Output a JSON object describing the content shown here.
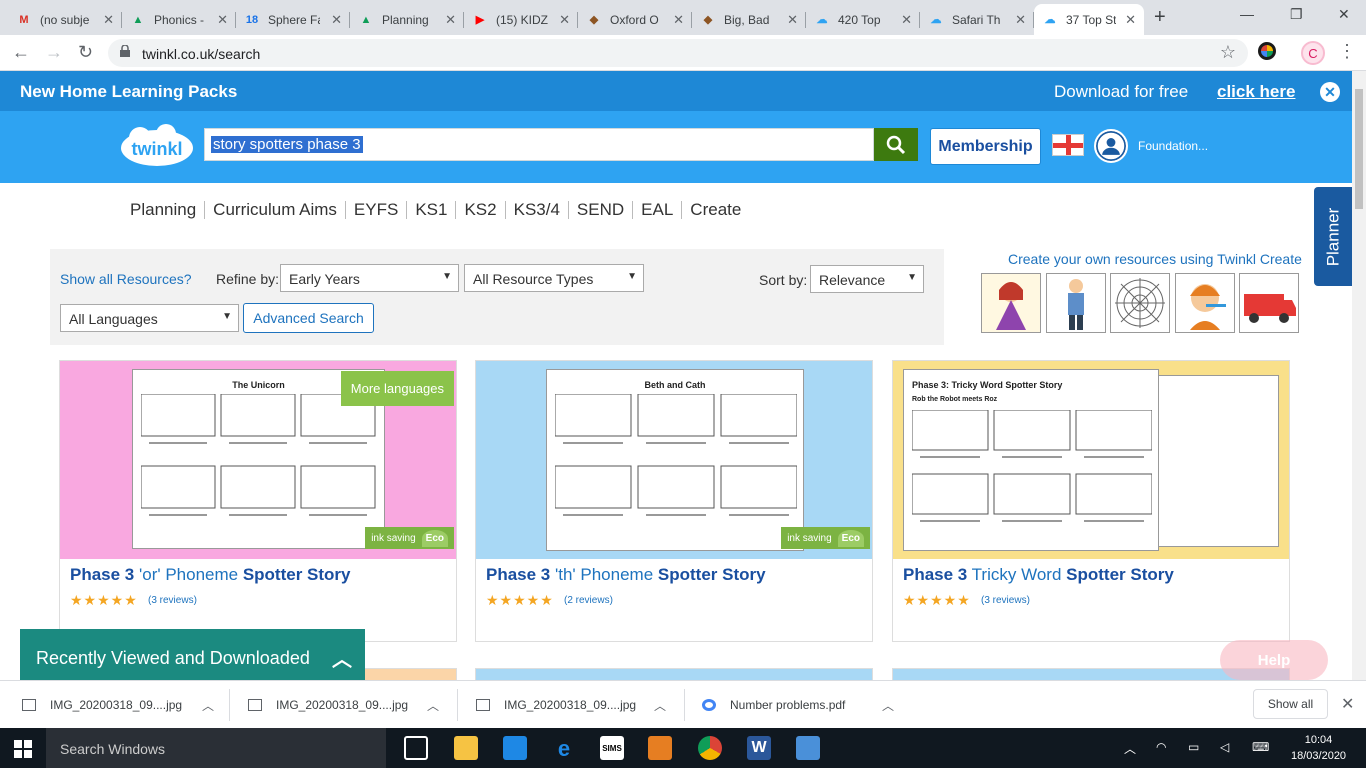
{
  "browser": {
    "tabs": [
      {
        "title": "(no subje",
        "icon": "gmail-icon",
        "color": "#d93025",
        "glyph": "M"
      },
      {
        "title": "Phonics -",
        "icon": "google-drive-icon",
        "color": "#0f9d58",
        "glyph": "▲"
      },
      {
        "title": "Sphere Fa",
        "icon": "calendar-icon",
        "color": "#1a73e8",
        "glyph": "18"
      },
      {
        "title": "Planning",
        "icon": "google-drive-icon",
        "color": "#0f9d58",
        "glyph": "▲"
      },
      {
        "title": "(15) KIDZ",
        "icon": "youtube-icon",
        "color": "#ff0000",
        "glyph": "▶"
      },
      {
        "title": "Oxford O",
        "icon": "owl-icon",
        "color": "#8d5524",
        "glyph": "◆"
      },
      {
        "title": "Big, Bad",
        "icon": "owl-icon",
        "color": "#8d5524",
        "glyph": "◆"
      },
      {
        "title": "420 Top",
        "icon": "twinkl-icon",
        "color": "#2ea3f2",
        "glyph": "☁"
      },
      {
        "title": "Safari Th",
        "icon": "twinkl-icon",
        "color": "#2ea3f2",
        "glyph": "☁"
      },
      {
        "title": "37 Top St",
        "icon": "twinkl-icon",
        "color": "#2ea3f2",
        "glyph": "☁"
      }
    ],
    "url": "twinkl.co.uk/search",
    "profile_initial": "C"
  },
  "promo": {
    "title": "New Home Learning Packs",
    "download_text": "Download for free",
    "link_text": "click here"
  },
  "header": {
    "search_value": "story spotters phase 3",
    "membership_label": "Membership",
    "account_label": "Foundation..."
  },
  "nav": [
    "Planning",
    "Curriculum Aims",
    "EYFS",
    "KS1",
    "KS2",
    "KS3/4",
    "SEND",
    "EAL",
    "Create"
  ],
  "planner_label": "Planner",
  "filters": {
    "show_all": "Show all Resources?",
    "refine_label": "Refine by:",
    "refine_value": "Early Years",
    "type_value": "All Resource Types",
    "sort_label": "Sort by:",
    "sort_value": "Relevance",
    "language_value": "All Languages",
    "advanced_search": "Advanced Search"
  },
  "create_text": "Create your own resources using Twinkl Create",
  "cards": [
    {
      "bold1": "Phase 3",
      "mid": " 'or' Phoneme ",
      "bold2": "Spotter Story",
      "stars": "★★★★★",
      "reviews": "(3 reviews)",
      "sheet_title": "The Unicorn",
      "badge": "More languages",
      "eco_text": "ink saving",
      "eco_leaf": "Eco",
      "bg": "#f9a8e0"
    },
    {
      "bold1": "Phase 3",
      "mid": " 'th' Phoneme ",
      "bold2": "Spotter Story",
      "stars": "★★★★★",
      "reviews": "(2 reviews)",
      "sheet_title": "Beth and Cath",
      "eco_text": "ink saving",
      "eco_leaf": "Eco",
      "bg": "#a8d8f5"
    },
    {
      "bold1": "Phase 3",
      "mid": " Tricky Word ",
      "bold2": "Spotter Story",
      "stars": "★★★★★",
      "reviews": "(3 reviews)",
      "sheet_title": "Phase 3: Tricky Word Spotter Story",
      "sheet_subtitle": "Rob the Robot meets Roz",
      "bg": "#f9e08a"
    }
  ],
  "recent": {
    "label": "Recently Viewed and Downloaded"
  },
  "help_label": "Help",
  "downloads": [
    {
      "name": "IMG_20200318_09....jpg"
    },
    {
      "name": "IMG_20200318_09....jpg"
    },
    {
      "name": "IMG_20200318_09....jpg"
    },
    {
      "name": "Number problems.pdf"
    }
  ],
  "show_all_label": "Show all",
  "taskbar": {
    "search_text": "Search Windows",
    "time": "10:04",
    "date": "18/03/2020"
  }
}
